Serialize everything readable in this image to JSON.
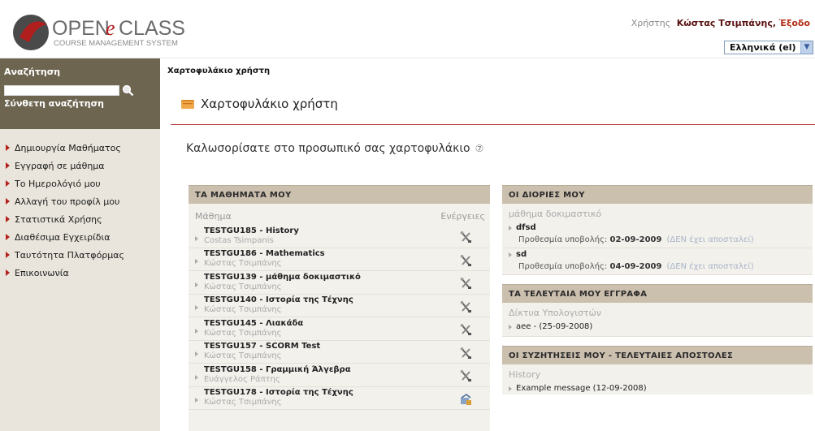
{
  "header": {
    "logo_text": "OPENeCLASS",
    "logo_subtitle": "COURSE MANAGEMENT SYSTEM",
    "user_label": "Χρήστης",
    "user_name": "Κώστας Τσιμπάνης,",
    "logout": "Έξοδο",
    "language": "Ελληνικά (el)"
  },
  "sidebar": {
    "search_title": "Αναζήτηση",
    "advanced_search": "Σύνθετη αναζήτηση",
    "items": [
      {
        "label": "Δημιουργία Μαθήματος"
      },
      {
        "label": "Εγγραφή σε μάθημα"
      },
      {
        "label": "Το Ημερολόγιό μου"
      },
      {
        "label": "Αλλαγή του προφίλ μου"
      },
      {
        "label": "Στατιστικά Χρήσης"
      },
      {
        "label": "Διαθέσιμα Εγχειρίδια"
      },
      {
        "label": "Ταυτότητα Πλατφόρμας"
      },
      {
        "label": "Επικοινωνία"
      }
    ]
  },
  "main": {
    "breadcrumb": "Χαρτοφυλάκιο χρήστη",
    "page_title": "Χαρτοφυλάκιο χρήστη",
    "welcome": "Καλωσορίσατε στο προσωπικό σας χαρτοφυλάκιο",
    "help_icon": "?"
  },
  "courses": {
    "heading": "ΤΑ ΜΑΘΗΜΑΤΑ ΜΟΥ",
    "col_course": "Μάθημα",
    "col_actions": "Ενέργειες",
    "rows": [
      {
        "title": "TESTGU185 - History",
        "prof": "Costas Tsimpanis",
        "action": "tools-icon"
      },
      {
        "title": "TESTGU186 - Mathematics",
        "prof": "Κώστας Τσιμπάνης",
        "action": "tools-icon"
      },
      {
        "title": "TESTGU139 - μάθημα δοκιμαστικό",
        "prof": "Κώστας Τσιμπάνης",
        "action": "tools-icon"
      },
      {
        "title": "TESTGU140 - Ιστορία της Τέχνης",
        "prof": "Κώστας Τσιμπάνης",
        "action": "tools-icon"
      },
      {
        "title": "TESTGU145 - Λιακάδα",
        "prof": "Κώστας Τσιμπάνης",
        "action": "tools-icon"
      },
      {
        "title": "TESTGU157 - SCORM Test",
        "prof": "Κώστας Τσιμπάνης",
        "action": "tools-icon"
      },
      {
        "title": "TESTGU158 - Γραμμική Άλγεβρα",
        "prof": "Ευάγγελος Ράπτης",
        "action": "tools-icon"
      },
      {
        "title": "TESTGU178 - Ιστορία της Τέχνης",
        "prof": "Κώστας Τσιμπάνης",
        "action": "unregister-icon"
      }
    ]
  },
  "assignments": {
    "heading": "ΟΙ ΔΙΟΡΙΕΣ ΜΟΥ",
    "course": "μάθημα δοκιμαστικό",
    "deadline_label": "Προθεσμία υποβολής:",
    "items": [
      {
        "title": "dfsd",
        "date": "02-09-2009",
        "status": "(ΔΕΝ έχει αποσταλεί)"
      },
      {
        "title": "sd",
        "date": "04-09-2009",
        "status": "(ΔΕΝ έχει αποσταλεί)"
      }
    ]
  },
  "documents": {
    "heading": "ΤΑ ΤΕΛΕΥΤΑΙΑ ΜΟΥ ΕΓΓΡΑΦΑ",
    "course": "Δίκτυα Υπολογιστών",
    "item": "aee - (25-09-2008)"
  },
  "forums": {
    "heading": "ΟΙ ΣΥΖΗΤΗΣΕΙΣ ΜΟΥ - ΤΕΛΕΥΤΑΙΕΣ ΑΠΟΣΤΟΛΕΣ",
    "course": "History",
    "item": "Example message (12-09-2008)"
  }
}
